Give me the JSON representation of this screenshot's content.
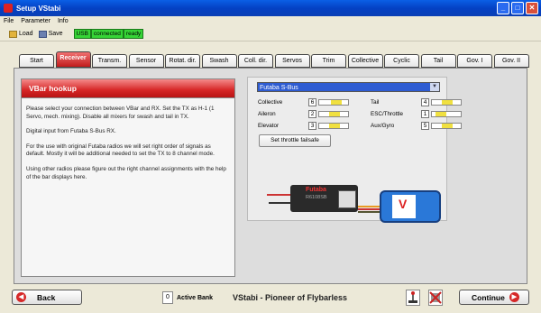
{
  "window": {
    "title": "Setup VStabi"
  },
  "menu": [
    "File",
    "Parameter",
    "Info"
  ],
  "toolbar": {
    "load": "Load",
    "save": "Save"
  },
  "status": [
    "USB",
    "connected",
    "ready"
  ],
  "tabs": [
    "Start",
    "Receiver",
    "Transm.",
    "Sensor",
    "Rotat. dir.",
    "Swash",
    "Coll. dir.",
    "Servos",
    "Trim",
    "Collective",
    "Cyclic",
    "Tail",
    "Gov. I",
    "Gov. II"
  ],
  "active_tab": "Receiver",
  "info": {
    "title": "VBar hookup",
    "paragraphs": [
      "Please select your connection between VBar and RX. Set the TX as H-1 (1 Servo, mech. mixing). Disable all mixers for swash and tail in TX.",
      "Digital input from Futaba S-Bus RX.",
      "For the use with original Futaba radios we will set right order of signals as default. Mostly it will be additional needed to set the TX to 8 channel mode.",
      "Using other radios please figure out the right channel assignments with the help of the bar displays here."
    ]
  },
  "receiver": {
    "selected": "Futaba S-Bus",
    "channels_left": [
      {
        "name": "Collective",
        "num": "6",
        "level": 0.55
      },
      {
        "name": "Aileron",
        "num": "2",
        "level": 0.5
      },
      {
        "name": "Elevator",
        "num": "3",
        "level": 0.5
      }
    ],
    "channels_right": [
      {
        "name": "Tail",
        "num": "4",
        "level": 0.5
      },
      {
        "name": "ESC/Throttle",
        "num": "1",
        "level": 0.3
      },
      {
        "name": "Aux/Gyro",
        "num": "5",
        "level": 0.5
      }
    ],
    "failsafe_label": "Set throttle failsafe",
    "rx_brand": "Futaba",
    "rx_model": "R6108SB",
    "vbar_text": "V"
  },
  "bottom": {
    "back": "Back",
    "bank_number": "0",
    "bank_label": "Active Bank",
    "slogan": "VStabi - Pioneer of Flybarless",
    "continue": "Continue"
  }
}
